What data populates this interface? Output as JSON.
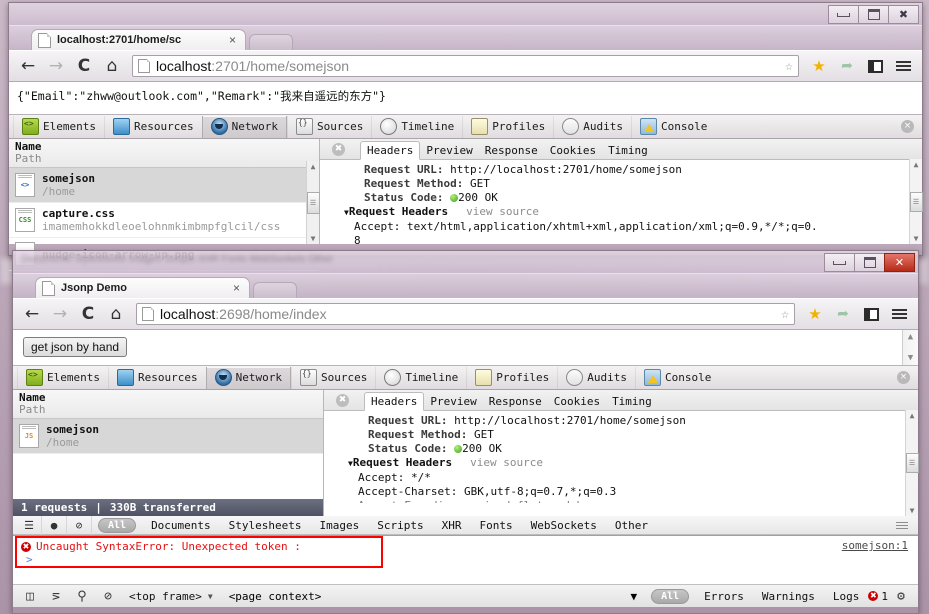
{
  "window_top": {
    "title_controls": {
      "minimize": "minimize-icon",
      "maximize": "maximize-icon",
      "close": "close-icon"
    },
    "tab": {
      "title": "localhost:2701/home/sc",
      "close": "×"
    },
    "nav": {
      "back": "←",
      "forward": "→",
      "reload": "C",
      "home": "⌂"
    },
    "omnibox": {
      "host": "localhost",
      "rest": ":2701/home/somejson",
      "bookmark_star": "☆"
    },
    "toolbar_icons": {
      "star": "★",
      "share": "share-icon",
      "bookmarks": "bookmarks-icon",
      "menu": "menu-icon"
    },
    "page_body": "{\"Email\":\"zhww@outlook.com\",\"Remark\":\"我来自遥远的东方\"}",
    "devtools": {
      "tabs": [
        {
          "label": "Elements",
          "icon": "elements-icon",
          "selected": false
        },
        {
          "label": "Resources",
          "icon": "resources-icon",
          "selected": false
        },
        {
          "label": "Network",
          "icon": "network-icon",
          "selected": true
        },
        {
          "label": "Sources",
          "icon": "sources-icon",
          "selected": false
        },
        {
          "label": "Timeline",
          "icon": "timeline-icon",
          "selected": false
        },
        {
          "label": "Profiles",
          "icon": "profiles-icon",
          "selected": false
        },
        {
          "label": "Audits",
          "icon": "audits-icon",
          "selected": false
        },
        {
          "label": "Console",
          "icon": "console-icon",
          "selected": false
        }
      ],
      "close_label": "×",
      "list_header": {
        "name": "Name",
        "path": "Path"
      },
      "requests": [
        {
          "name": "somejson",
          "path": "/home",
          "kind": "code",
          "badge": "<>",
          "selected": true
        },
        {
          "name": "capture.css",
          "path": "imamemhokkdleoelohnmkimbmpfglcil/css",
          "kind": "css",
          "badge": "CSS",
          "selected": false
        },
        {
          "name": "nudge-icon-arrow-up.png",
          "path": "",
          "kind": "img",
          "badge": "",
          "selected": false
        }
      ],
      "subtabs": [
        {
          "label": "Headers",
          "selected": true
        },
        {
          "label": "Preview",
          "selected": false
        },
        {
          "label": "Response",
          "selected": false
        },
        {
          "label": "Cookies",
          "selected": false
        },
        {
          "label": "Timing",
          "selected": false
        }
      ],
      "headers": {
        "request_url_key": "Request URL:",
        "request_url_val": "http://localhost:2701/home/somejson",
        "request_method_key": "Request Method:",
        "request_method_val": "GET",
        "status_key": "Status Code:",
        "status_val": "200 OK",
        "section": "Request Headers",
        "view_source": "view source",
        "accept_line": "Accept: text/html,application/xhtml+xml,application/xml;q=0.9,*/*;q=0.",
        "accept_wrap": "8"
      }
    }
  },
  "window_bottom": {
    "title_controls": {
      "minimize": "minimize-icon",
      "maximize": "maximize-icon",
      "close": "✕"
    },
    "tab": {
      "title": "Jsonp Demo",
      "close": "×"
    },
    "nav": {
      "back": "←",
      "forward": "→",
      "reload": "C",
      "home": "⌂"
    },
    "omnibox": {
      "host": "localhost",
      "rest": ":2698/home/index",
      "bookmark_star": "☆"
    },
    "toolbar_icons": {
      "star": "★",
      "share": "share-icon",
      "bookmarks": "bookmarks-icon",
      "menu": "menu-icon"
    },
    "page_button": "get json by hand",
    "devtools": {
      "tabs": [
        {
          "label": "Elements",
          "icon": "elements-icon",
          "selected": false
        },
        {
          "label": "Resources",
          "icon": "resources-icon",
          "selected": false
        },
        {
          "label": "Network",
          "icon": "network-icon",
          "selected": true
        },
        {
          "label": "Sources",
          "icon": "sources-icon",
          "selected": false
        },
        {
          "label": "Timeline",
          "icon": "timeline-icon",
          "selected": false
        },
        {
          "label": "Profiles",
          "icon": "profiles-icon",
          "selected": false
        },
        {
          "label": "Audits",
          "icon": "audits-icon",
          "selected": false
        },
        {
          "label": "Console",
          "icon": "console-icon",
          "selected": false
        }
      ],
      "close_label": "×",
      "list_header": {
        "name": "Name",
        "path": "Path"
      },
      "requests": [
        {
          "name": "somejson",
          "path": "/home",
          "kind": "js",
          "badge": "JS",
          "selected": true
        }
      ],
      "summary": {
        "requests": "1 requests",
        "sep": "|",
        "transferred": "330B transferred"
      },
      "subtabs": [
        {
          "label": "Headers",
          "selected": true
        },
        {
          "label": "Preview",
          "selected": false
        },
        {
          "label": "Response",
          "selected": false
        },
        {
          "label": "Cookies",
          "selected": false
        },
        {
          "label": "Timing",
          "selected": false
        }
      ],
      "headers": {
        "request_url_key": "Request URL:",
        "request_url_val": "http://localhost:2701/home/somejson",
        "request_method_key": "Request Method:",
        "request_method_val": "GET",
        "status_key": "Status Code:",
        "status_val": "200 OK",
        "section": "Request Headers",
        "view_source": "view source",
        "accept_line": "Accept: */*",
        "accept_charset_line": "Accept-Charset: GBK,utf-8;q=0.7,*;q=0.3",
        "accept_encoding_line": "Accept-Encoding: gzip,deflate,sdch"
      },
      "filter_bar": {
        "icons": [
          "list-view-icon",
          "record-icon",
          "clear-icon"
        ],
        "all_pill": "All",
        "categories": [
          "Documents",
          "Stylesheets",
          "Images",
          "Scripts",
          "XHR",
          "Fonts",
          "WebSockets",
          "Other"
        ]
      },
      "console": {
        "error_text": "Uncaught SyntaxError: Unexpected token :",
        "error_source": "somejson:1",
        "prompt": ">",
        "bar": {
          "icons": [
            "dock-icon",
            "console-toggle-icon",
            "search-icon",
            "clear-icon"
          ],
          "frame_selector": "<top frame>",
          "context_selector": "<page context>",
          "all_pill": "All",
          "levels": [
            "Errors",
            "Warnings",
            "Logs"
          ],
          "error_count": "1",
          "settings": "gear-icon"
        }
      }
    }
  },
  "colors": {
    "error_red": "#e81010",
    "error_box": "#ff0000",
    "status_ok": "#3aa11a",
    "summary_bg": "#4e5263",
    "close_active": "#b62b18"
  }
}
